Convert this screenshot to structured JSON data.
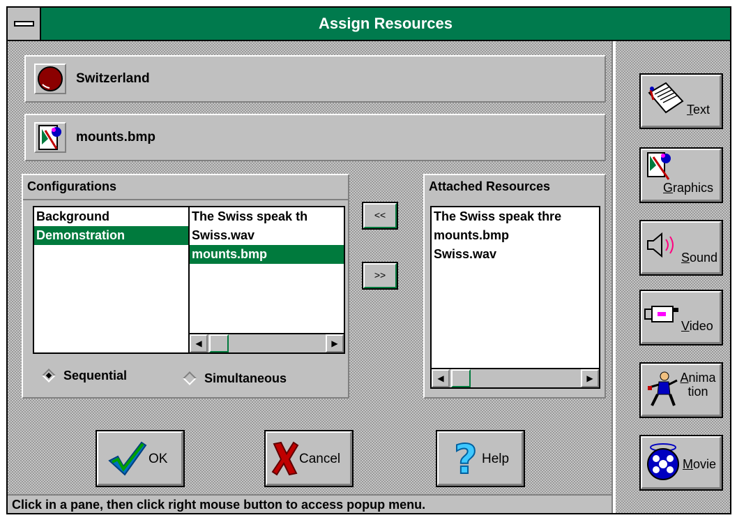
{
  "window": {
    "title": "Assign Resources"
  },
  "topic": {
    "label": "Switzerland",
    "icon": "topic-ball-icon"
  },
  "resource": {
    "label": "mounts.bmp",
    "icon": "graphics-file-icon"
  },
  "configurations": {
    "title": "Configurations",
    "names": [
      {
        "label": "Background",
        "selected": false
      },
      {
        "label": "Demonstration",
        "selected": true
      }
    ],
    "resources": [
      {
        "label": "The Swiss speak th",
        "selected": false
      },
      {
        "label": "Swiss.wav",
        "selected": false
      },
      {
        "label": "mounts.bmp",
        "selected": true
      }
    ],
    "modes": [
      {
        "label": "Sequential",
        "checked": true
      },
      {
        "label": "Simultaneous",
        "checked": false
      }
    ]
  },
  "transfer": {
    "remove_label": "<<",
    "add_label": ">>"
  },
  "attached": {
    "title": "Attached Resources",
    "items": [
      "The Swiss speak thre",
      "mounts.bmp",
      "Swiss.wav"
    ]
  },
  "buttons": {
    "ok": "OK",
    "cancel": "Cancel",
    "help": "Help"
  },
  "resource_types": {
    "text": {
      "mnemonic": "T",
      "rest": "ext"
    },
    "graphics": {
      "mnemonic": "G",
      "rest": "raphics"
    },
    "sound": {
      "mnemonic": "S",
      "rest": "ound"
    },
    "video": {
      "mnemonic": "V",
      "rest": "ideo"
    },
    "animation": {
      "mnemonic": "A",
      "rest": "nima",
      "line2": "tion"
    },
    "movie": {
      "mnemonic": "M",
      "rest": "ovie"
    }
  },
  "status": "Click in a pane, then click right mouse button to access popup menu.",
  "colors": {
    "title_bar": "#007a4d",
    "selection": "#007a3d",
    "face": "#c0c0c0"
  }
}
